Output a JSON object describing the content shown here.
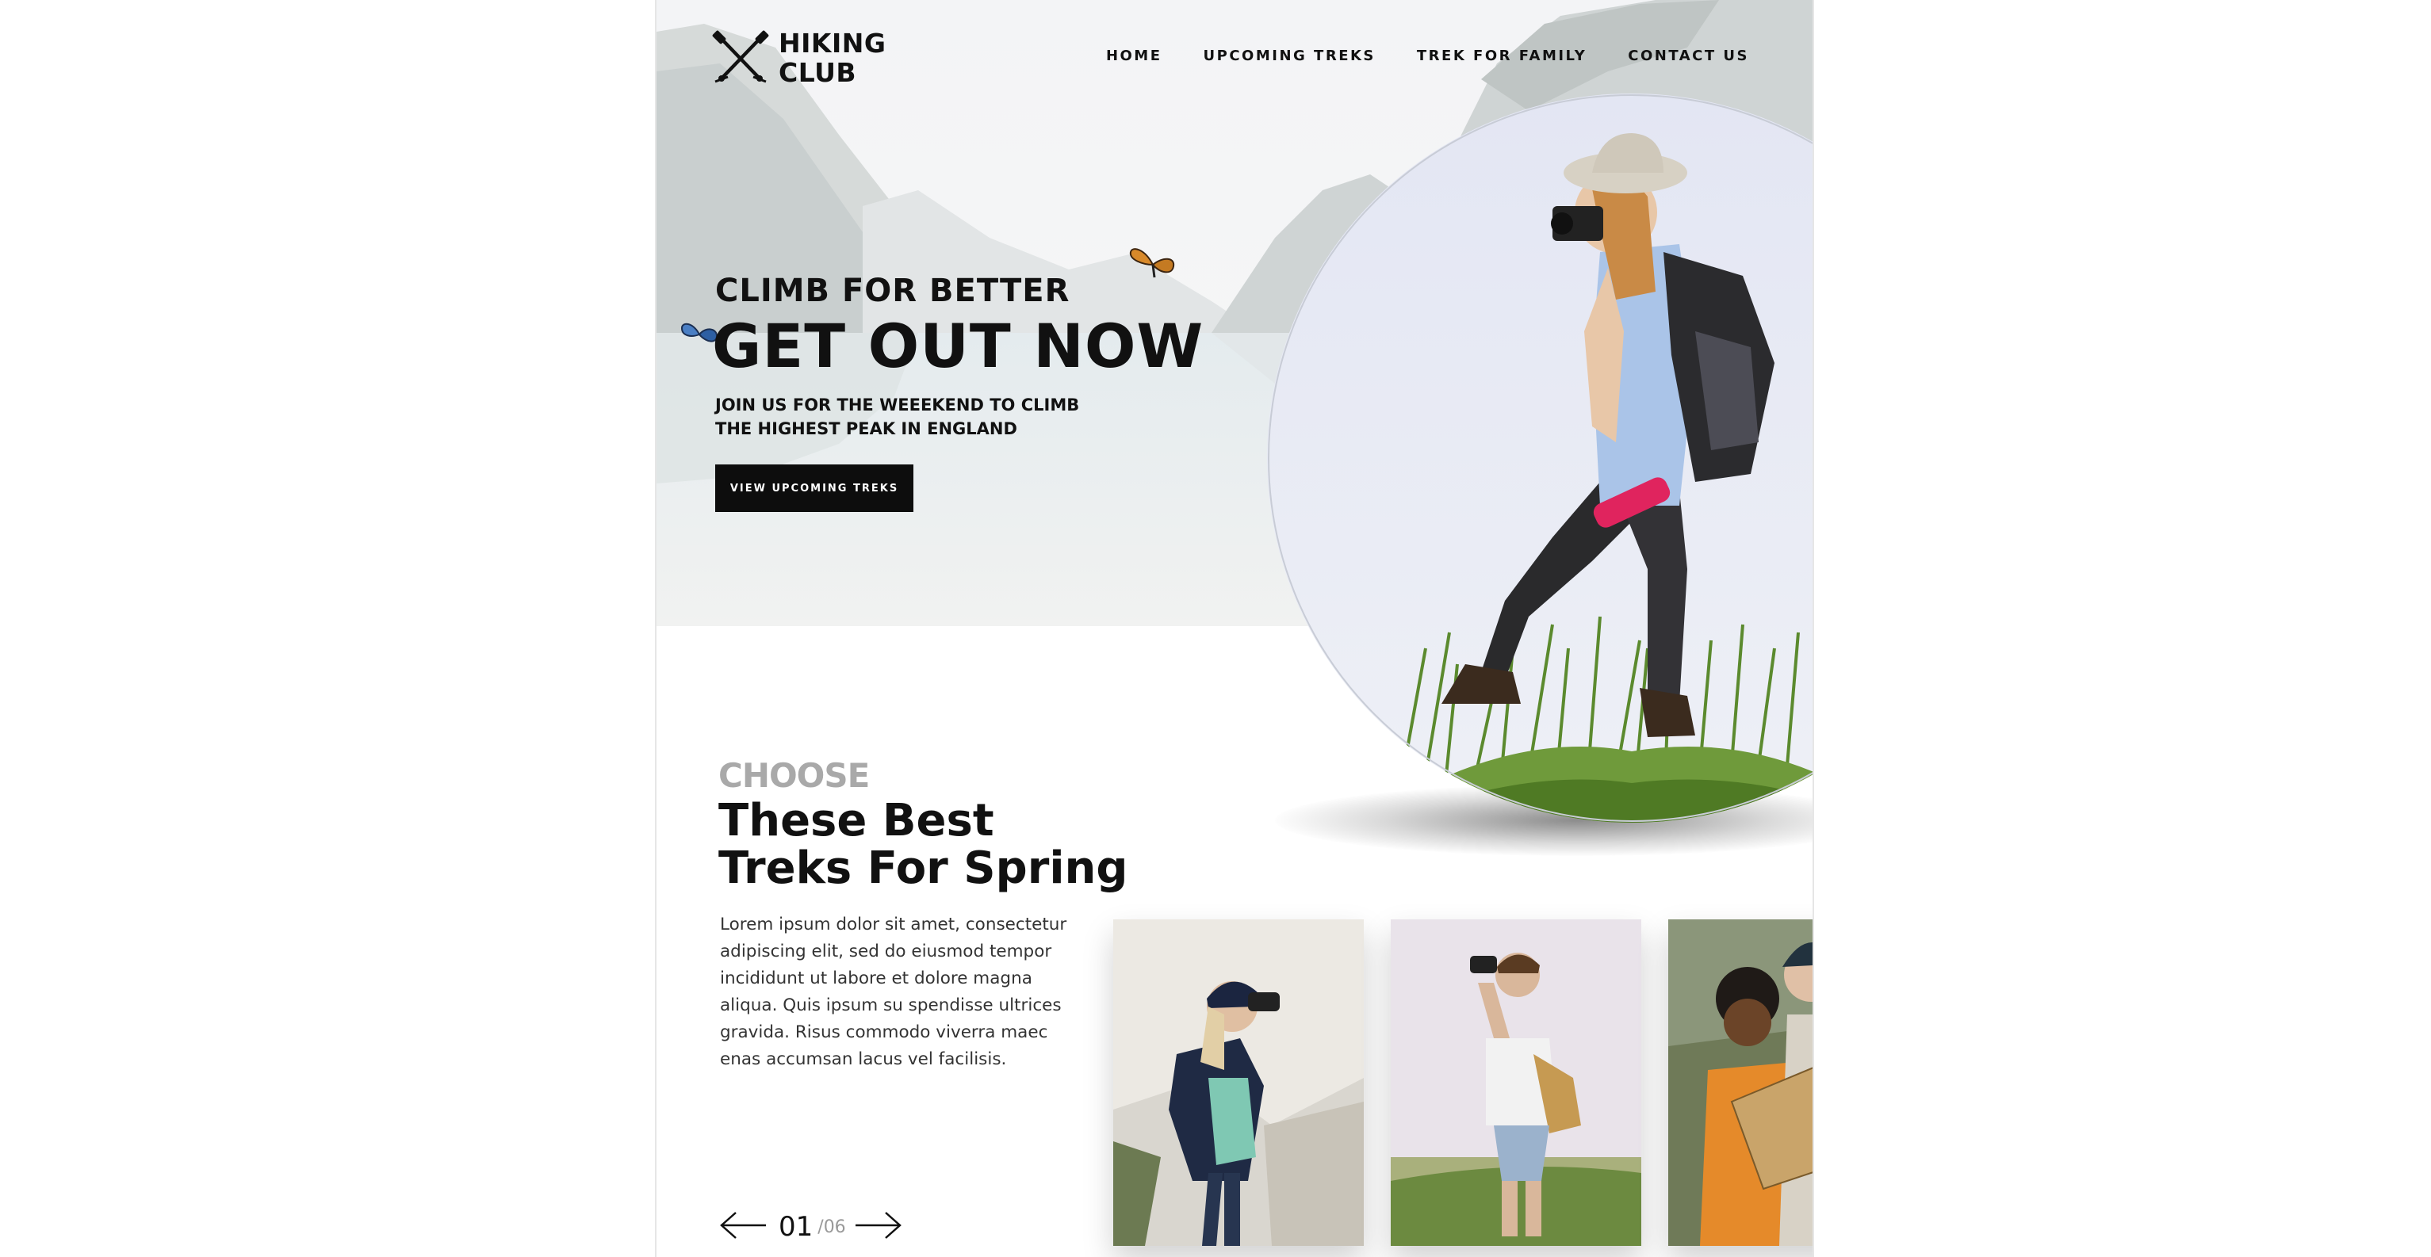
{
  "brand": {
    "line1": "HIKING",
    "line2": "CLUB",
    "icon": "crossed-hiking-poles-icon"
  },
  "nav": {
    "items": [
      "HOME",
      "UPCOMING TREKS",
      "TREK FOR FAMILY",
      "CONTACT US"
    ]
  },
  "hero": {
    "eyebrow": "CLIMB FOR BETTER",
    "headline": "GET OUT NOW",
    "subline_1": "JOIN US FOR THE WEEEKEND TO CLIMB",
    "subline_2": "THE HIGHEST PEAK IN ENGLAND",
    "cta_label": "VIEW UPCOMING TREKS",
    "image": "hiker-woman-with-camera-photo",
    "background": "mountain-lake-photo"
  },
  "section": {
    "eyebrow": "CHOOSE",
    "title_1": "These Best",
    "title_2": "Treks For Spring",
    "body": "Lorem ipsum dolor sit amet, consectetur adipiscing elit, sed do eiusmod tempor incididunt ut labore et dolore magna aliqua. Quis ipsum su spendisse ultrices gravida. Risus commodo viverra maec enas accumsan lacus vel facilisis."
  },
  "pager": {
    "current": "01",
    "separator": "/",
    "total": "06",
    "prev_icon": "arrow-left-icon",
    "next_icon": "arrow-right-icon"
  },
  "cards": [
    {
      "image": "woman-with-binoculars-photo"
    },
    {
      "image": "man-with-binoculars-photo"
    },
    {
      "image": "hikers-reading-map-photo"
    }
  ],
  "colors": {
    "text": "#111111",
    "muted": "#a9a9a9",
    "button": "#0d0d0d",
    "accent": "#e0245e"
  }
}
